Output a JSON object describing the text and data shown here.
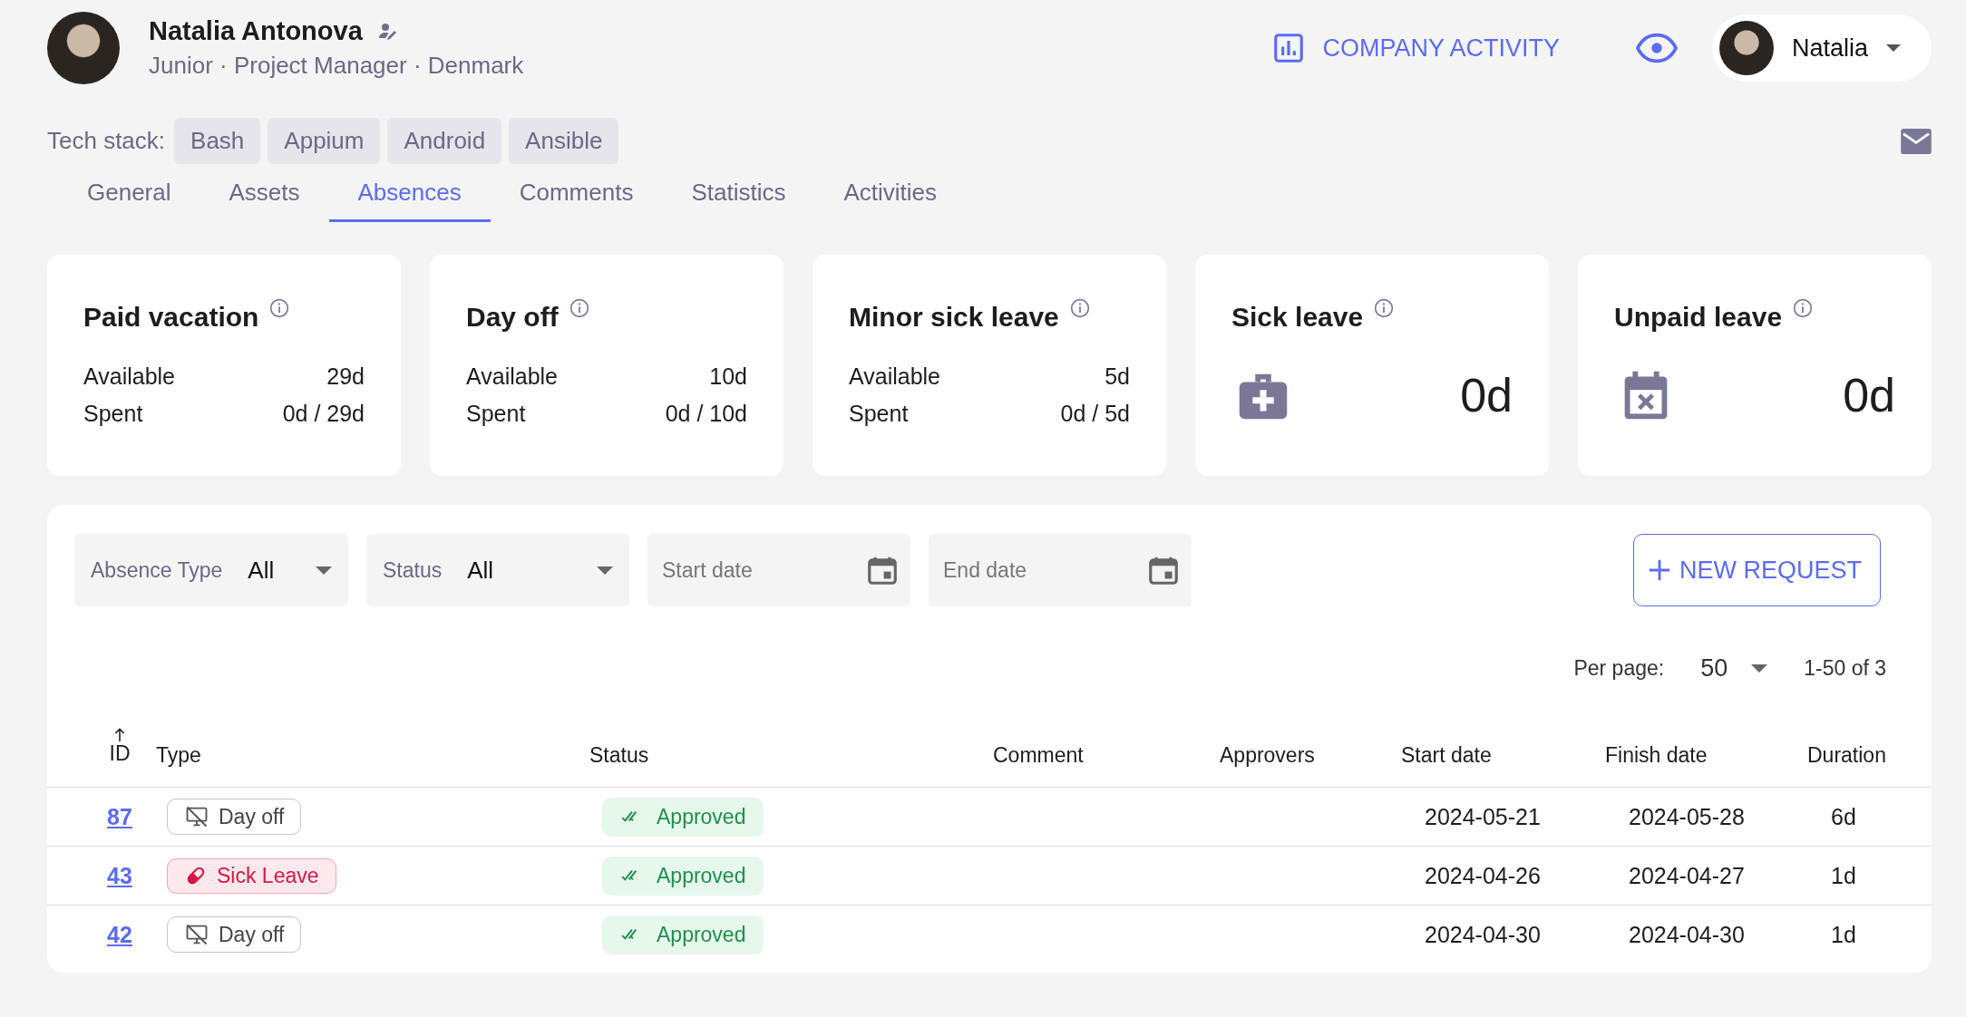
{
  "profile": {
    "name": "Natalia Antonova",
    "subtitle": "Junior · Project Manager · Denmark"
  },
  "header_actions": {
    "company_activity": "COMPANY ACTIVITY",
    "user_menu": "Natalia"
  },
  "tech_stack": {
    "label": "Tech stack:",
    "tags": [
      "Bash",
      "Appium",
      "Android",
      "Ansible"
    ]
  },
  "tabs": [
    {
      "label": "General",
      "selected": false
    },
    {
      "label": "Assets",
      "selected": false
    },
    {
      "label": "Absences",
      "selected": true
    },
    {
      "label": "Comments",
      "selected": false
    },
    {
      "label": "Statistics",
      "selected": false
    },
    {
      "label": "Activities",
      "selected": false
    }
  ],
  "cards": [
    {
      "kind": "balance",
      "title": "Paid vacation",
      "rows": [
        {
          "label": "Available",
          "value": "29d"
        },
        {
          "label": "Spent",
          "value": "0d / 29d"
        }
      ]
    },
    {
      "kind": "balance",
      "title": "Day off",
      "rows": [
        {
          "label": "Available",
          "value": "10d"
        },
        {
          "label": "Spent",
          "value": "0d / 10d"
        }
      ]
    },
    {
      "kind": "balance",
      "title": "Minor sick leave",
      "rows": [
        {
          "label": "Available",
          "value": "5d"
        },
        {
          "label": "Spent",
          "value": "0d / 5d"
        }
      ]
    },
    {
      "kind": "sick",
      "title": "Sick leave",
      "total": "0d"
    },
    {
      "kind": "unpaid",
      "title": "Unpaid leave",
      "total": "0d"
    }
  ],
  "filters": [
    {
      "kind": "select",
      "label": "Absence Type",
      "value": "All"
    },
    {
      "kind": "select",
      "label": "Status",
      "value": "All"
    },
    {
      "kind": "date",
      "placeholder": "Start date"
    },
    {
      "kind": "date",
      "placeholder": "End date"
    }
  ],
  "new_request_button": "NEW REQUEST",
  "pagination": {
    "label": "Per page:",
    "per_page": "50",
    "range": "1-50 of 3"
  },
  "table": {
    "columns": [
      {
        "label": "ID",
        "sorted": true
      },
      {
        "label": "Type",
        "sorted": false
      },
      {
        "label": "Status",
        "sorted": false
      },
      {
        "label": "Comment",
        "sorted": false
      },
      {
        "label": "Approvers",
        "sorted": false
      },
      {
        "label": "Start date",
        "sorted": false
      },
      {
        "label": "Finish date",
        "sorted": false
      },
      {
        "label": "Duration",
        "sorted": false
      }
    ],
    "rows": [
      {
        "id": "87",
        "type": {
          "kind": "dayoff",
          "label": "Day off"
        },
        "status": {
          "kind": "approved",
          "label": "Approved"
        },
        "start": "2024-05-21",
        "finish": "2024-05-28",
        "duration": "6d"
      },
      {
        "id": "43",
        "type": {
          "kind": "sick",
          "label": "Sick Leave"
        },
        "status": {
          "kind": "approved",
          "label": "Approved"
        },
        "start": "2024-04-26",
        "finish": "2024-04-27",
        "duration": "1d"
      },
      {
        "id": "42",
        "type": {
          "kind": "dayoff",
          "label": "Day off"
        },
        "status": {
          "kind": "approved",
          "label": "Approved"
        },
        "start": "2024-04-30",
        "finish": "2024-04-30",
        "duration": "1d"
      }
    ]
  }
}
